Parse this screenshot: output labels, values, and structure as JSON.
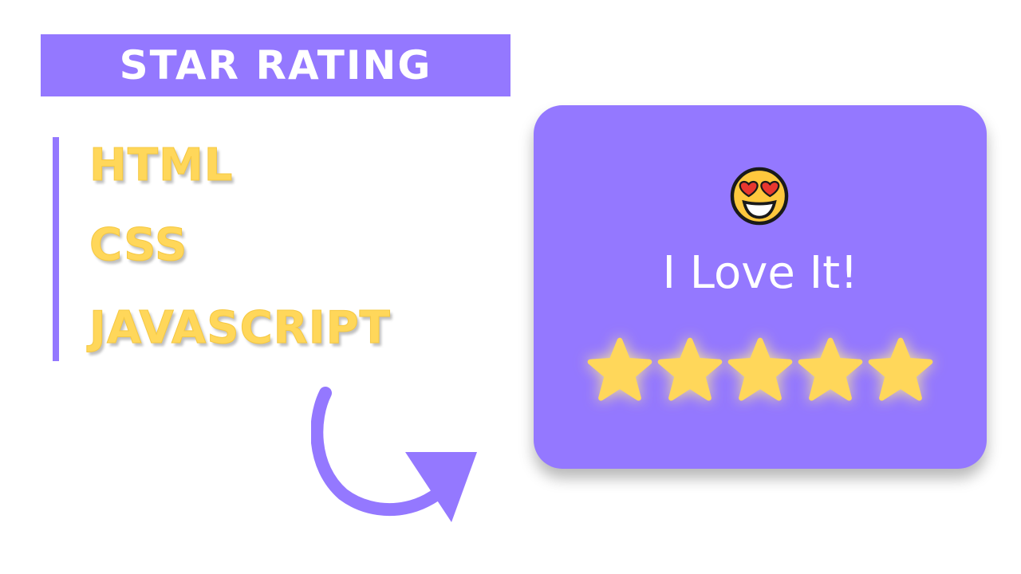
{
  "banner": {
    "title": "STAR RATING"
  },
  "tech": {
    "items": [
      "HTML",
      "CSS",
      "JAVASCRIPT"
    ]
  },
  "rating_card": {
    "emoji": "heart-eyes-emoji",
    "label": "I Love It!",
    "rating": 5,
    "max_rating": 5
  },
  "colors": {
    "accent": "#9478ff",
    "star": "#ffd75a",
    "text_yellow": "#ffd75a",
    "white": "#ffffff"
  },
  "icons": {
    "arrow": "curved-arrow-icon",
    "star": "star-icon"
  }
}
